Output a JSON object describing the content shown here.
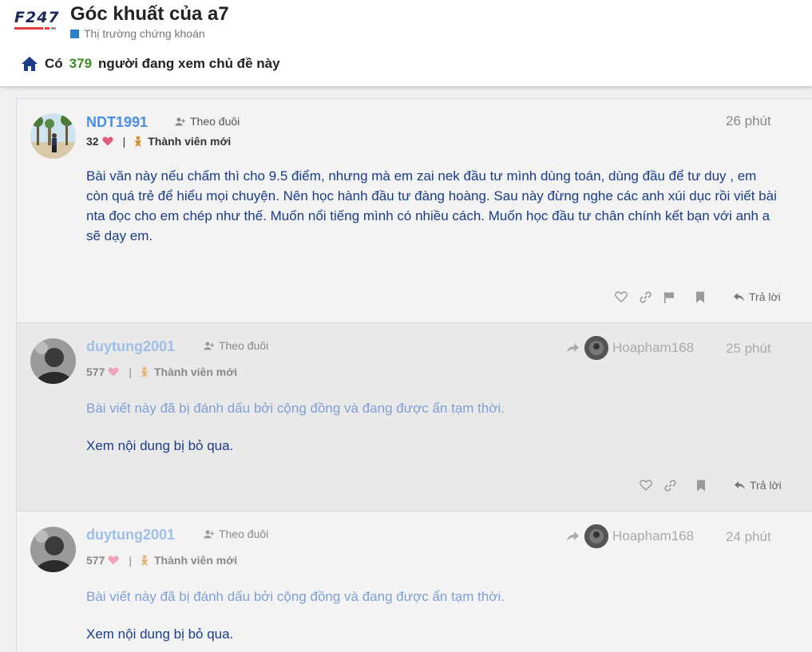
{
  "header": {
    "logo_text": "F247",
    "topic_title": "Góc khuất của a7",
    "category": "Thị trường chứng khoán",
    "category_color": "#2a7fc9",
    "viewers_prefix": "Có",
    "viewers_count": "379",
    "viewers_suffix": "người đang xem chủ đề này"
  },
  "posts": [
    {
      "username": "NDT1991",
      "follow_label": "Theo đuôi",
      "likes": "32",
      "sep": "|",
      "badge": "Thành viên mới",
      "time": "26 phút",
      "body": "Bài văn này nếu chấm thì cho 9.5 điểm, nhưng mà em zai nek đầu tư mình dùng toán, dùng đầu để tư duy , em còn quá trẻ để hiểu mọi chuyện. Nên học hành đầu tư đàng hoàng. Sau này đừng nghe các anh xúi dục rồi viết bài nta đọc cho em chép như thế. Muốn nổi tiếng mình có nhiều cách. Muốn học đầu tư chân chính kết bạn với anh a sẽ dạy em.",
      "reply_label": "Trả lời"
    },
    {
      "username": "duytung2001",
      "follow_label": "Theo đuôi",
      "likes": "577",
      "sep": "|",
      "badge": "Thành viên mới",
      "reply_to_user": "Hoapham168",
      "time": "25 phút",
      "hidden_note": "Bài viết này đã bị đánh dấu bởi cộng đồng và đang được ẩn tạm thời.",
      "show_link": "Xem nội dung bị bỏ qua.",
      "reply_label": "Trả lời"
    },
    {
      "username": "duytung2001",
      "follow_label": "Theo đuôi",
      "likes": "577",
      "sep": "|",
      "badge": "Thành viên mới",
      "reply_to_user": "Hoapham168",
      "time": "24 phút",
      "hidden_note": "Bài viết này đã bị đánh dấu bởi cộng đồng và đang được ẩn tạm thời.",
      "show_link": "Xem nội dung bị bỏ qua."
    }
  ]
}
